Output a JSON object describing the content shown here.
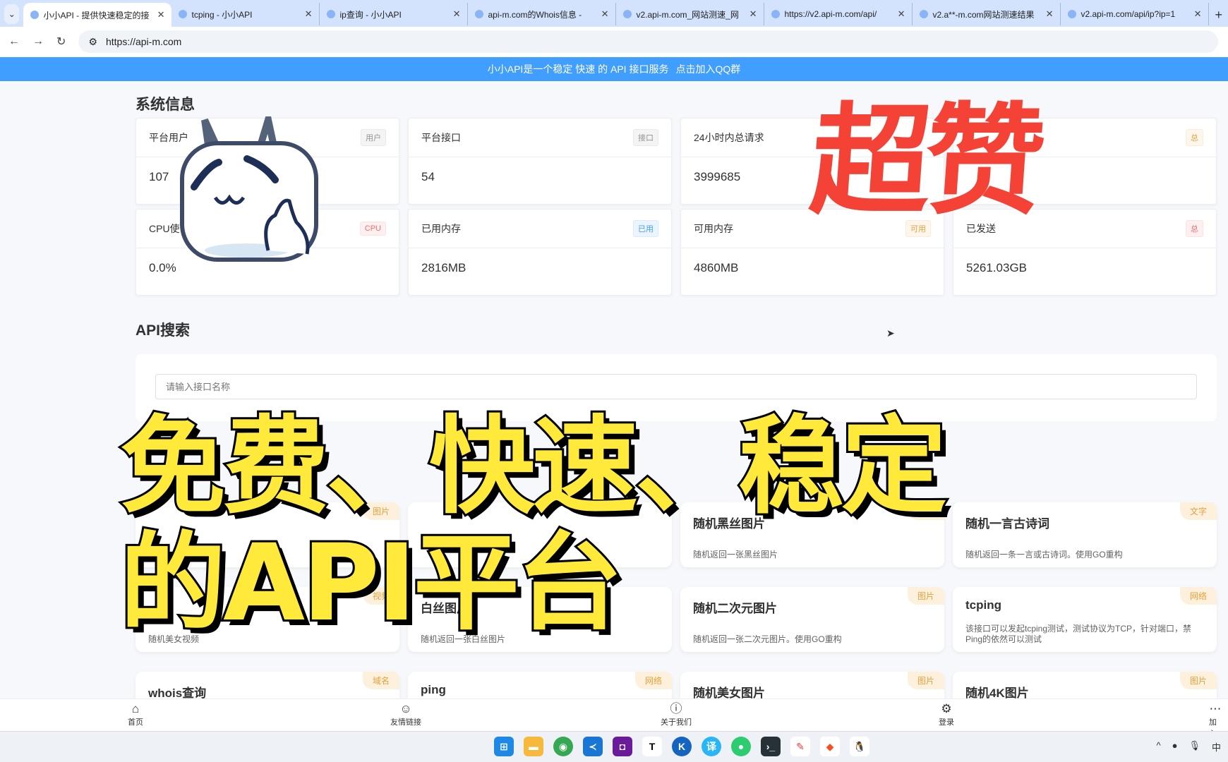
{
  "browser": {
    "tabs": [
      {
        "title": "小小API - 提供快速稳定的接"
      },
      {
        "title": "tcping - 小小API"
      },
      {
        "title": "ip查询 - 小小API"
      },
      {
        "title": "api-m.com的Whois信息 - "
      },
      {
        "title": "v2.api-m.com_网站测速_网"
      },
      {
        "title": "https://v2.api-m.com/api/"
      },
      {
        "title": "v2.a**-m.com网站测速结果"
      },
      {
        "title": "v2.api-m.com/api/ip?ip=1"
      }
    ],
    "url": "https://api-m.com"
  },
  "banner": {
    "text": "小小API是一个稳定 快速 的 API 接口服务",
    "link": "点击加入QQ群"
  },
  "system": {
    "title": "系统信息",
    "cards": [
      {
        "label": "平台用户",
        "tag": "用户",
        "value": "107",
        "color": "gray"
      },
      {
        "label": "平台接口",
        "tag": "接口",
        "value": "54",
        "color": "gray"
      },
      {
        "label": "24小时内总请求",
        "tag": "",
        "value": "3999685",
        "color": "gray"
      },
      {
        "label": "",
        "tag": "总",
        "value": "",
        "color": "orange"
      },
      {
        "label": "CPU使",
        "tag": "CPU",
        "value": "0.0%",
        "color": "red"
      },
      {
        "label": "已用内存",
        "tag": "已用",
        "value": "2816MB",
        "color": "blue"
      },
      {
        "label": "可用内存",
        "tag": "可用",
        "value": "4860MB",
        "color": "orange"
      },
      {
        "label": "已发送",
        "tag": "总",
        "value": "5261.03GB",
        "color": "red"
      }
    ]
  },
  "search": {
    "title": "API搜索",
    "placeholder": "请输入接口名称"
  },
  "apis": [
    {
      "name": "",
      "tag": "图片",
      "desc": ""
    },
    {
      "name": "",
      "tag": "",
      "desc": ""
    },
    {
      "name": "随机黑丝图片",
      "tag": "图片",
      "desc": "随机返回一张黑丝图片"
    },
    {
      "name": "随机一言古诗词",
      "tag": "文字",
      "desc": "随机返回一条一言或古诗词。使用GO重构"
    },
    {
      "name": "",
      "tag": "视频",
      "desc": "随机美女视频"
    },
    {
      "name": "白丝图片",
      "tag": "",
      "desc": "随机返回一张白丝图片"
    },
    {
      "name": "随机二次元图片",
      "tag": "图片",
      "desc": "随机返回一张二次元图片。使用GO重构"
    },
    {
      "name": "tcping",
      "tag": "网络",
      "desc": "该接口可以发起tcping测试，测试协议为TCP，针对端口，禁Ping的依然可以测试"
    },
    {
      "name": "whois查询",
      "tag": "域名",
      "desc": ""
    },
    {
      "name": "ping",
      "tag": "网络",
      "desc": ""
    },
    {
      "name": "随机美女图片",
      "tag": "图片",
      "desc": ""
    },
    {
      "name": "随机4K图片",
      "tag": "图片",
      "desc": ""
    }
  ],
  "bottom_nav": [
    {
      "label": "首页"
    },
    {
      "label": "友情链接"
    },
    {
      "label": "关于我们"
    },
    {
      "label": "登录"
    },
    {
      "label": "加入群聊"
    }
  ],
  "overlay": {
    "line1": "免费、快速、稳定",
    "line2": "的API平台",
    "badge": "超赞"
  },
  "tray": {
    "ime": "中"
  }
}
